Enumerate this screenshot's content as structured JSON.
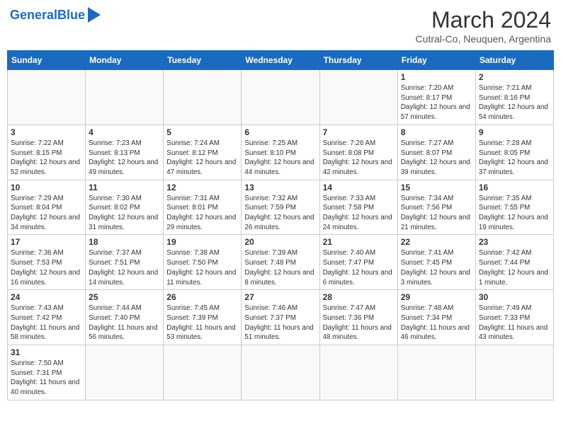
{
  "header": {
    "logo_general": "General",
    "logo_blue": "Blue",
    "month_year": "March 2024",
    "location": "Cutral-Co, Neuquen, Argentina"
  },
  "weekdays": [
    "Sunday",
    "Monday",
    "Tuesday",
    "Wednesday",
    "Thursday",
    "Friday",
    "Saturday"
  ],
  "weeks": [
    [
      {
        "day": "",
        "info": ""
      },
      {
        "day": "",
        "info": ""
      },
      {
        "day": "",
        "info": ""
      },
      {
        "day": "",
        "info": ""
      },
      {
        "day": "",
        "info": ""
      },
      {
        "day": "1",
        "info": "Sunrise: 7:20 AM\nSunset: 8:17 PM\nDaylight: 12 hours and 57 minutes."
      },
      {
        "day": "2",
        "info": "Sunrise: 7:21 AM\nSunset: 8:16 PM\nDaylight: 12 hours and 54 minutes."
      }
    ],
    [
      {
        "day": "3",
        "info": "Sunrise: 7:22 AM\nSunset: 8:15 PM\nDaylight: 12 hours and 52 minutes."
      },
      {
        "day": "4",
        "info": "Sunrise: 7:23 AM\nSunset: 8:13 PM\nDaylight: 12 hours and 49 minutes."
      },
      {
        "day": "5",
        "info": "Sunrise: 7:24 AM\nSunset: 8:12 PM\nDaylight: 12 hours and 47 minutes."
      },
      {
        "day": "6",
        "info": "Sunrise: 7:25 AM\nSunset: 8:10 PM\nDaylight: 12 hours and 44 minutes."
      },
      {
        "day": "7",
        "info": "Sunrise: 7:26 AM\nSunset: 8:08 PM\nDaylight: 12 hours and 42 minutes."
      },
      {
        "day": "8",
        "info": "Sunrise: 7:27 AM\nSunset: 8:07 PM\nDaylight: 12 hours and 39 minutes."
      },
      {
        "day": "9",
        "info": "Sunrise: 7:28 AM\nSunset: 8:05 PM\nDaylight: 12 hours and 37 minutes."
      }
    ],
    [
      {
        "day": "10",
        "info": "Sunrise: 7:29 AM\nSunset: 8:04 PM\nDaylight: 12 hours and 34 minutes."
      },
      {
        "day": "11",
        "info": "Sunrise: 7:30 AM\nSunset: 8:02 PM\nDaylight: 12 hours and 31 minutes."
      },
      {
        "day": "12",
        "info": "Sunrise: 7:31 AM\nSunset: 8:01 PM\nDaylight: 12 hours and 29 minutes."
      },
      {
        "day": "13",
        "info": "Sunrise: 7:32 AM\nSunset: 7:59 PM\nDaylight: 12 hours and 26 minutes."
      },
      {
        "day": "14",
        "info": "Sunrise: 7:33 AM\nSunset: 7:58 PM\nDaylight: 12 hours and 24 minutes."
      },
      {
        "day": "15",
        "info": "Sunrise: 7:34 AM\nSunset: 7:56 PM\nDaylight: 12 hours and 21 minutes."
      },
      {
        "day": "16",
        "info": "Sunrise: 7:35 AM\nSunset: 7:55 PM\nDaylight: 12 hours and 19 minutes."
      }
    ],
    [
      {
        "day": "17",
        "info": "Sunrise: 7:36 AM\nSunset: 7:53 PM\nDaylight: 12 hours and 16 minutes."
      },
      {
        "day": "18",
        "info": "Sunrise: 7:37 AM\nSunset: 7:51 PM\nDaylight: 12 hours and 14 minutes."
      },
      {
        "day": "19",
        "info": "Sunrise: 7:38 AM\nSunset: 7:50 PM\nDaylight: 12 hours and 11 minutes."
      },
      {
        "day": "20",
        "info": "Sunrise: 7:39 AM\nSunset: 7:48 PM\nDaylight: 12 hours and 8 minutes."
      },
      {
        "day": "21",
        "info": "Sunrise: 7:40 AM\nSunset: 7:47 PM\nDaylight: 12 hours and 6 minutes."
      },
      {
        "day": "22",
        "info": "Sunrise: 7:41 AM\nSunset: 7:45 PM\nDaylight: 12 hours and 3 minutes."
      },
      {
        "day": "23",
        "info": "Sunrise: 7:42 AM\nSunset: 7:44 PM\nDaylight: 12 hours and 1 minute."
      }
    ],
    [
      {
        "day": "24",
        "info": "Sunrise: 7:43 AM\nSunset: 7:42 PM\nDaylight: 11 hours and 58 minutes."
      },
      {
        "day": "25",
        "info": "Sunrise: 7:44 AM\nSunset: 7:40 PM\nDaylight: 11 hours and 56 minutes."
      },
      {
        "day": "26",
        "info": "Sunrise: 7:45 AM\nSunset: 7:39 PM\nDaylight: 11 hours and 53 minutes."
      },
      {
        "day": "27",
        "info": "Sunrise: 7:46 AM\nSunset: 7:37 PM\nDaylight: 11 hours and 51 minutes."
      },
      {
        "day": "28",
        "info": "Sunrise: 7:47 AM\nSunset: 7:36 PM\nDaylight: 11 hours and 48 minutes."
      },
      {
        "day": "29",
        "info": "Sunrise: 7:48 AM\nSunset: 7:34 PM\nDaylight: 11 hours and 46 minutes."
      },
      {
        "day": "30",
        "info": "Sunrise: 7:49 AM\nSunset: 7:33 PM\nDaylight: 11 hours and 43 minutes."
      }
    ],
    [
      {
        "day": "31",
        "info": "Sunrise: 7:50 AM\nSunset: 7:31 PM\nDaylight: 11 hours and 40 minutes."
      },
      {
        "day": "",
        "info": ""
      },
      {
        "day": "",
        "info": ""
      },
      {
        "day": "",
        "info": ""
      },
      {
        "day": "",
        "info": ""
      },
      {
        "day": "",
        "info": ""
      },
      {
        "day": "",
        "info": ""
      }
    ]
  ]
}
